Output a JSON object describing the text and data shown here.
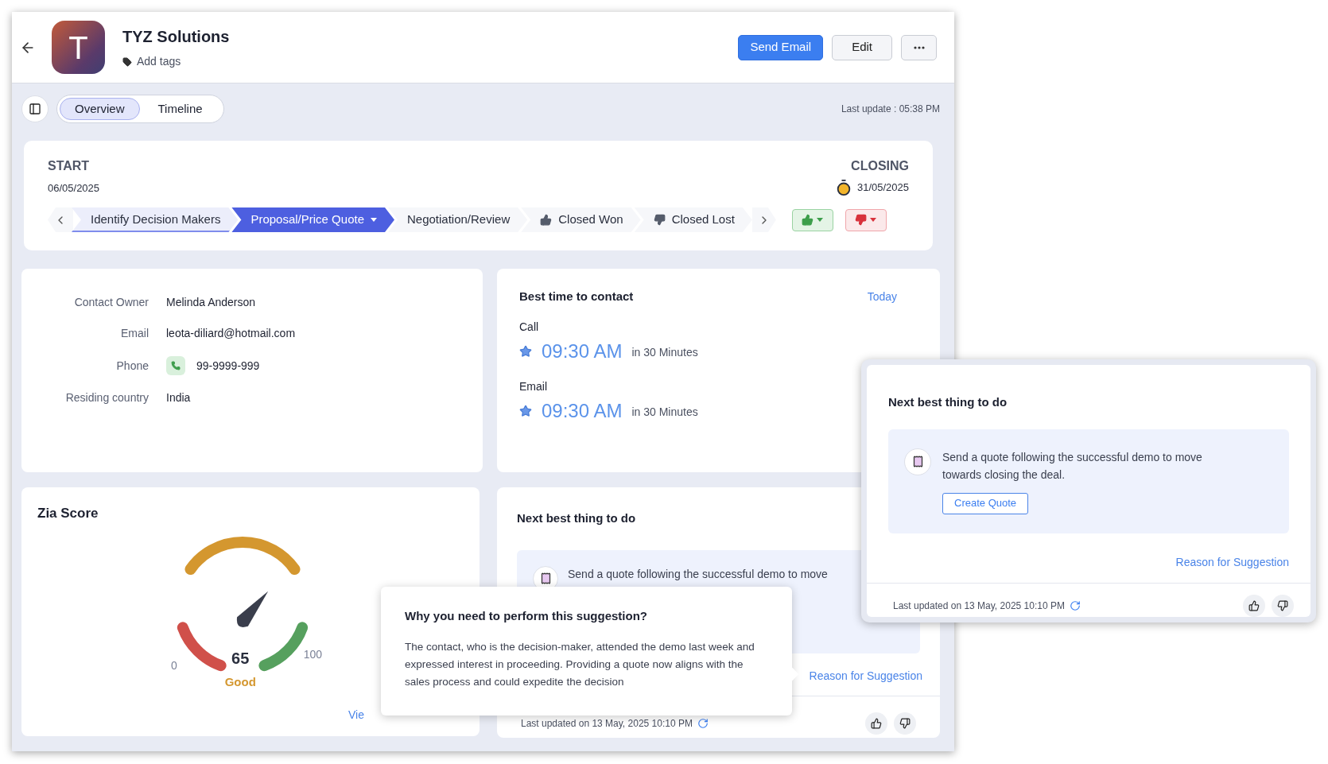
{
  "header": {
    "avatar_letter": "T",
    "title": "TYZ Solutions",
    "tags_link": "Add tags",
    "buttons": [
      {
        "label": "Send Email",
        "kind": "primary"
      },
      {
        "label": "Edit",
        "kind": "secondary"
      },
      {
        "kind": "more"
      }
    ]
  },
  "tabs": [
    {
      "label": "Overview",
      "selected": true
    },
    {
      "label": "Timeline",
      "selected": false
    }
  ],
  "last_update": "Last update : 05:38 PM",
  "pipeline": {
    "start_label": "START",
    "start_date": "06/05/2025",
    "closing_label": "CLOSING",
    "closing_date": "31/05/2025",
    "stages": [
      {
        "label": "Identify Decision Makers",
        "kind": "stage",
        "completed": true,
        "selected": false
      },
      {
        "label": "Proposal/Price Quote",
        "kind": "stage",
        "completed": false,
        "selected": true
      },
      {
        "label": "Negotiation/Review",
        "kind": "stage",
        "completed": false,
        "selected": false
      },
      {
        "label": "Closed Won",
        "kind": "won",
        "completed": false,
        "selected": false
      },
      {
        "label": "Closed Lost",
        "kind": "lost",
        "completed": false,
        "selected": false
      }
    ]
  },
  "contact": {
    "fields": [
      {
        "label": "Contact Owner",
        "value": "Melinda Anderson",
        "kind": "text"
      },
      {
        "label": "Email",
        "value": "leota-diliard@hotmail.com",
        "kind": "text"
      },
      {
        "label": "Phone",
        "value": "99-9999-999",
        "kind": "phone"
      },
      {
        "label": "Residing country",
        "value": "India",
        "kind": "text"
      }
    ]
  },
  "best_time": {
    "title": "Best time to contact",
    "filter": "Today",
    "slots": [
      {
        "channel": "Call",
        "time": "09:30 AM",
        "relative": "in 30 Minutes"
      },
      {
        "channel": "Email",
        "time": "09:30 AM",
        "relative": "in 30 Minutes"
      }
    ]
  },
  "zia_score": {
    "title": "Zia Score",
    "min": "0",
    "max": "100",
    "score": "65",
    "rating": "Good",
    "link": "Vie"
  },
  "next_best": {
    "title": "Next best thing to do",
    "suggestion": "Send a quote following the successful demo to move",
    "reason_link": "Reason for Suggestion",
    "updated": "Last updated on 13 May, 2025  10:10 PM"
  },
  "tooltip": {
    "title": "Why you need to perform this suggestion?",
    "body": "The contact, who is the decision-maker, attended the demo last week and expressed interest in proceeding. Providing a quote now aligns with the sales process and could expedite the decision"
  },
  "popup": {
    "title": "Next best thing to do",
    "suggestion": "Send a quote following the successful demo to move towards closing the deal.",
    "action": "Create Quote",
    "reason_link": "Reason for Suggestion",
    "updated": "Last updated on 13 May, 2025  10:10 PM"
  }
}
